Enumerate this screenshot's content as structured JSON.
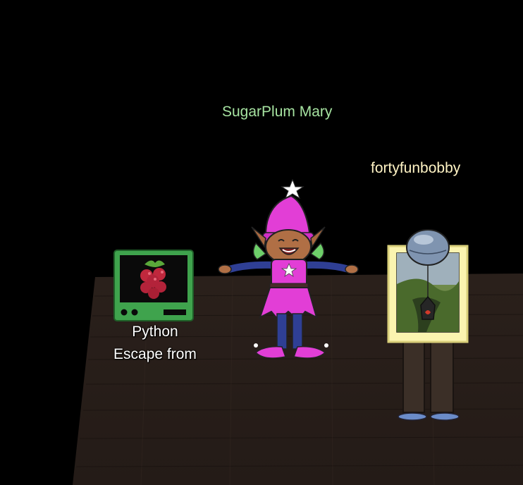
{
  "npc": {
    "name": "SugarPlum Mary",
    "name_color": "#a6e3a1"
  },
  "player": {
    "name": "fortyfunbobby",
    "name_color": "#fff3c4"
  },
  "terminal": {
    "line1": "Python",
    "line2": "Escape from",
    "icon": "raspberry-icon",
    "frame_color": "#3fa34d"
  },
  "colors": {
    "background": "#000000",
    "floor": "#2b211c",
    "floor_plank_line": "#1a1310"
  }
}
